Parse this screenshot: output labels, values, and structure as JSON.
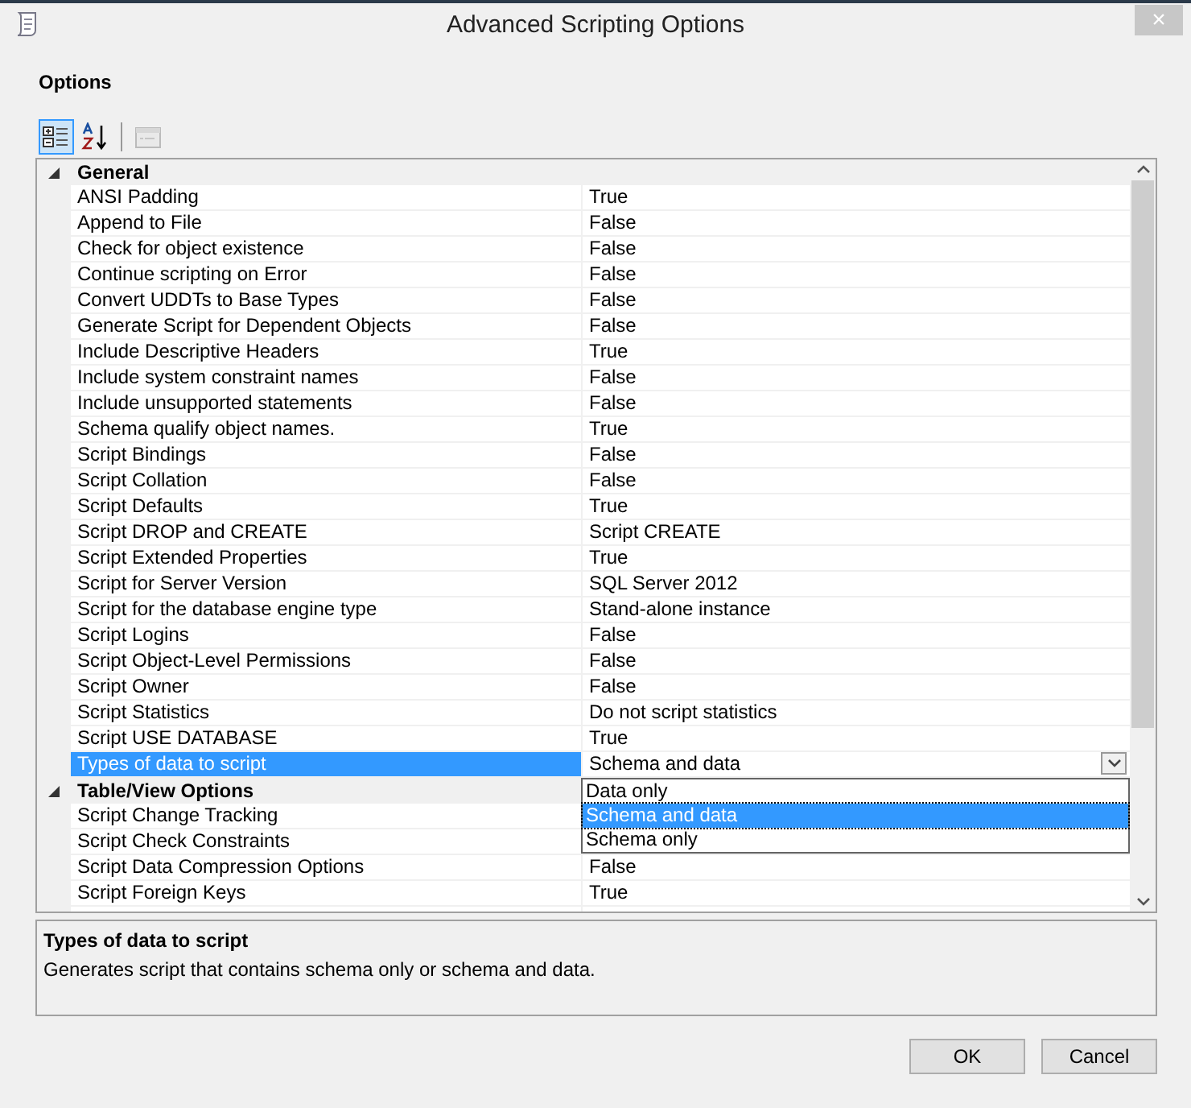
{
  "window": {
    "title": "Advanced Scripting Options",
    "close": "×"
  },
  "section_title": "Options",
  "toolbar": [
    {
      "kind": "categorized",
      "selected": true,
      "disabled": false
    },
    {
      "kind": "alphabetical",
      "selected": false,
      "disabled": false
    },
    {
      "kind": "pages",
      "selected": false,
      "disabled": true
    }
  ],
  "categories": [
    {
      "name": "General",
      "expanded": true,
      "properties": [
        {
          "name": "ANSI Padding",
          "value": "True",
          "selected": false
        },
        {
          "name": "Append to File",
          "value": "False",
          "selected": false
        },
        {
          "name": "Check for object existence",
          "value": "False",
          "selected": false
        },
        {
          "name": "Continue scripting on Error",
          "value": "False",
          "selected": false
        },
        {
          "name": "Convert UDDTs to Base Types",
          "value": "False",
          "selected": false
        },
        {
          "name": "Generate Script for Dependent Objects",
          "value": "False",
          "selected": false
        },
        {
          "name": "Include Descriptive Headers",
          "value": "True",
          "selected": false
        },
        {
          "name": "Include system constraint names",
          "value": "False",
          "selected": false
        },
        {
          "name": "Include unsupported statements",
          "value": "False",
          "selected": false
        },
        {
          "name": "Schema qualify object names.",
          "value": "True",
          "selected": false
        },
        {
          "name": "Script Bindings",
          "value": "False",
          "selected": false
        },
        {
          "name": "Script Collation",
          "value": "False",
          "selected": false
        },
        {
          "name": "Script Defaults",
          "value": "True",
          "selected": false
        },
        {
          "name": "Script DROP and CREATE",
          "value": "Script CREATE",
          "selected": false
        },
        {
          "name": "Script Extended Properties",
          "value": "True",
          "selected": false
        },
        {
          "name": "Script for Server Version",
          "value": "SQL Server 2012",
          "selected": false
        },
        {
          "name": "Script for the database engine type",
          "value": "Stand-alone instance",
          "selected": false
        },
        {
          "name": "Script Logins",
          "value": "False",
          "selected": false
        },
        {
          "name": "Script Object-Level Permissions",
          "value": "False",
          "selected": false
        },
        {
          "name": "Script Owner",
          "value": "False",
          "selected": false
        },
        {
          "name": "Script Statistics",
          "value": "Do not script statistics",
          "selected": false
        },
        {
          "name": "Script USE DATABASE",
          "value": "True",
          "selected": false
        },
        {
          "name": "Types of data to script",
          "value": "Schema and data",
          "selected": true
        }
      ]
    },
    {
      "name": "Table/View Options",
      "expanded": true,
      "properties": [
        {
          "name": "Script Change Tracking",
          "selected": false
        },
        {
          "name": "Script Check Constraints",
          "selected": false
        },
        {
          "name": "Script Data Compression Options",
          "value": "False",
          "selected": false
        },
        {
          "name": "Script Foreign Keys",
          "value": "True",
          "selected": false
        }
      ]
    }
  ],
  "dropdown": {
    "options": [
      {
        "label": "Data only",
        "selected": false
      },
      {
        "label": "Schema and data",
        "selected": true
      },
      {
        "label": "Schema only",
        "selected": false
      }
    ]
  },
  "description": {
    "title": "Types of data to script",
    "text": "Generates script that contains schema only or schema and data."
  },
  "buttons": [
    "OK",
    "Cancel"
  ]
}
